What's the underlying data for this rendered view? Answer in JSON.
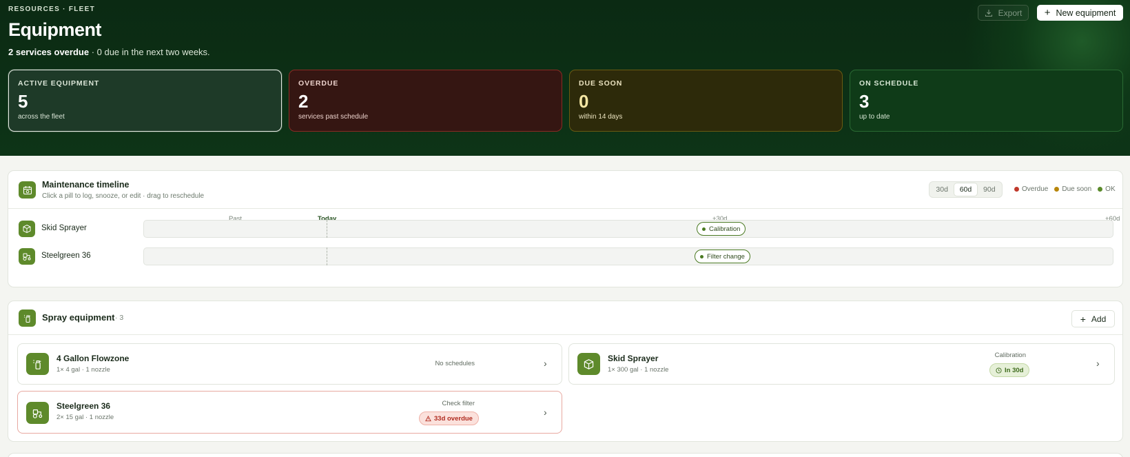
{
  "header": {
    "breadcrumb": "RESOURCES · FLEET",
    "title": "Equipment",
    "summary_bold": "2 services overdue",
    "summary_rest": " · 0 due in the next two weeks.",
    "export_label": "Export",
    "new_label": "New equipment"
  },
  "stats": [
    {
      "label": "ACTIVE EQUIPMENT",
      "value": "5",
      "caption": "across the fleet"
    },
    {
      "label": "OVERDUE",
      "value": "2",
      "caption": "services past schedule"
    },
    {
      "label": "DUE SOON",
      "value": "0",
      "caption": "within 14 days"
    },
    {
      "label": "ON SCHEDULE",
      "value": "3",
      "caption": "up to date"
    }
  ],
  "timeline": {
    "title": "Maintenance timeline",
    "subtitle": "Click a pill to log, snooze, or edit · drag to reschedule",
    "ranges": [
      "30d",
      "60d",
      "90d"
    ],
    "selected_range": "60d",
    "legend": [
      {
        "label": "Overdue",
        "color": "#c0392b"
      },
      {
        "label": "Due soon",
        "color": "#b8860b"
      },
      {
        "label": "OK",
        "color": "#5a8a2a"
      }
    ],
    "axis": [
      "Past",
      "Today",
      "+30d",
      "+60d"
    ],
    "rows": [
      {
        "name": "Skid Sprayer",
        "icon": "box-icon",
        "pill": "Calibration"
      },
      {
        "name": "Steelgreen 36",
        "icon": "tractor-icon",
        "pill": "Filter change"
      }
    ]
  },
  "spray": {
    "title": "Spray equipment",
    "count": "· 3",
    "add_label": "Add",
    "items": [
      {
        "name": "4 Gallon Flowzone",
        "meta": "1× 4 gal · 1 nozzle",
        "schedule": "No schedules",
        "badge": ""
      },
      {
        "name": "Skid Sprayer",
        "meta": "1× 300 gal · 1 nozzle",
        "schedule": "Calibration",
        "badge": "In 30d"
      },
      {
        "name": "Steelgreen 36",
        "meta": "2× 15 gal · 1 nozzle",
        "schedule": "Check filter",
        "badge": "33d overdue"
      }
    ]
  }
}
